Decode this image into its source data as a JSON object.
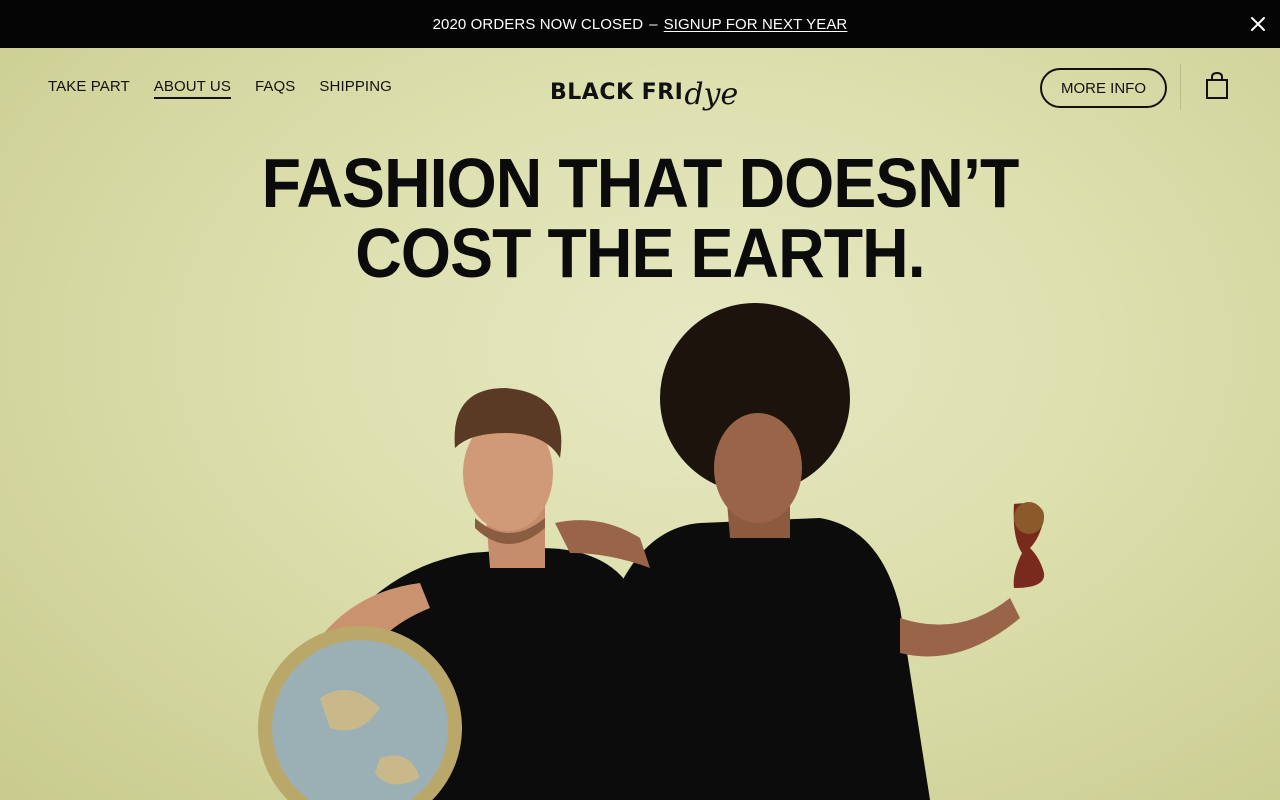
{
  "announcement": {
    "text": "2020 ORDERS NOW CLOSED",
    "separator": "–",
    "link_label": "SIGNUP FOR NEXT YEAR",
    "close_icon": "close-icon"
  },
  "nav": {
    "items": [
      {
        "label": "TAKE PART",
        "active": false
      },
      {
        "label": "ABOUT US",
        "active": true
      },
      {
        "label": "FAQS",
        "active": false
      },
      {
        "label": "SHIPPING",
        "active": false
      }
    ]
  },
  "logo": {
    "word": "BLACK FRI",
    "script": "dye"
  },
  "header_actions": {
    "more_info_label": "MORE INFO",
    "cart_icon": "shopping-bag-icon"
  },
  "hero": {
    "headline_line1": "FASHION THAT DOESN’T",
    "headline_line2": "COST THE EARTH.",
    "background_color": "#dcdfad"
  }
}
